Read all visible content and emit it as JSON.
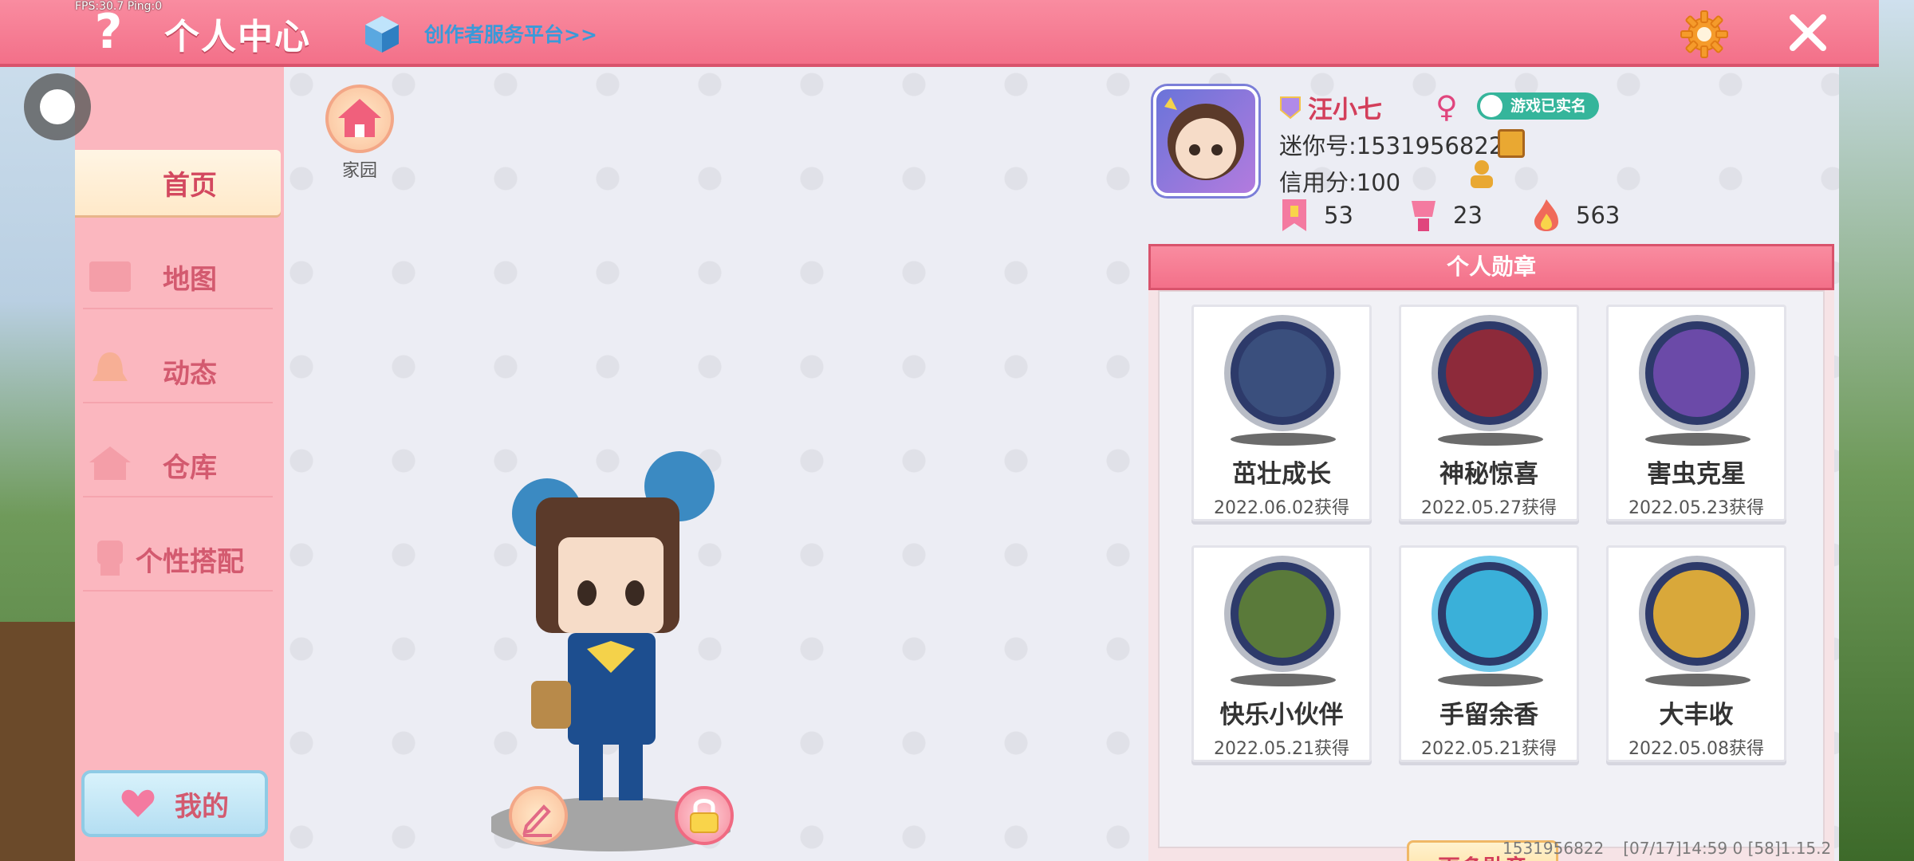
{
  "debug": {
    "fps_text": "FPS:30.7  Ping:0"
  },
  "header": {
    "title": "个人中心",
    "creator_link": "创作者服务平台>>",
    "help_label": "?"
  },
  "sidebar": {
    "items": [
      {
        "label": "首页",
        "active": true
      },
      {
        "label": "地图",
        "active": false
      },
      {
        "label": "动态",
        "active": false
      },
      {
        "label": "仓库",
        "active": false
      },
      {
        "label": "个性搭配",
        "active": false
      }
    ],
    "mine_label": "我的"
  },
  "home": {
    "label": "家园"
  },
  "profile": {
    "nickname": "汪小七",
    "verified_label": "游戏已实名",
    "mini_id": "迷你号:1531956822",
    "credit": "信用分:100",
    "stats": [
      {
        "icon": "bookmark-icon",
        "value": "53"
      },
      {
        "icon": "trophy-person-icon",
        "value": "23"
      },
      {
        "icon": "flame-icon",
        "value": "563"
      }
    ]
  },
  "medals": {
    "title": "个人勋章",
    "items": [
      {
        "name": "茁壮成长",
        "date": "2022.06.02获得",
        "color": "#3a4f7d"
      },
      {
        "name": "神秘惊喜",
        "date": "2022.05.27获得",
        "color": "#8d2a3a"
      },
      {
        "name": "害虫克星",
        "date": "2022.05.23获得",
        "color": "#6b4aa8"
      },
      {
        "name": "快乐小伙伴",
        "date": "2022.05.21获得",
        "color": "#5a7a3a"
      },
      {
        "name": "手留余香",
        "date": "2022.05.21获得",
        "color": "#3ab0d9"
      },
      {
        "name": "大丰收",
        "date": "2022.05.08获得",
        "color": "#d9a83a"
      }
    ],
    "more_label": "更多勋章"
  },
  "footer": {
    "id": "1531956822",
    "build": "[07/17]14:59 0  [58]1.15.2"
  },
  "colors": {
    "accent": "#f37089",
    "text_red": "#d33e5a",
    "sidebar_bg": "#fbb7bf"
  }
}
